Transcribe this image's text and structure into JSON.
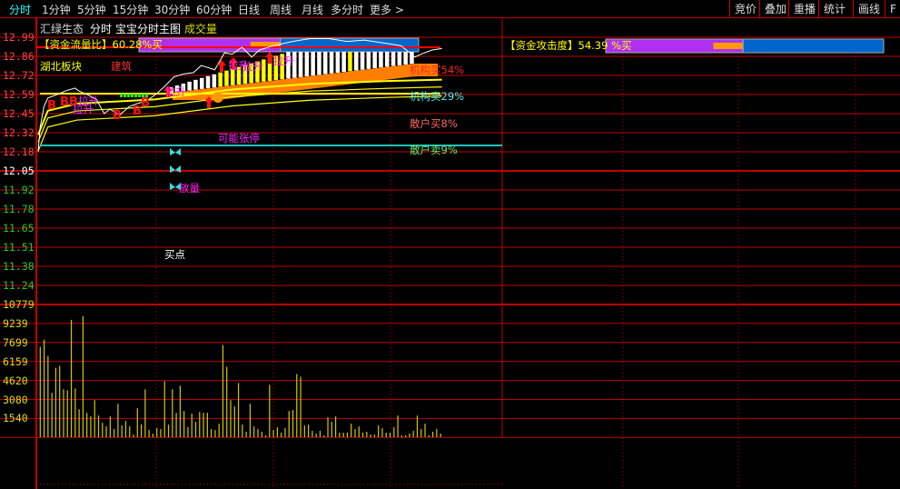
{
  "toolbar": {
    "tabs": [
      {
        "label": "分时",
        "selected": true
      },
      {
        "label": "1分钟"
      },
      {
        "label": "5分钟"
      },
      {
        "label": "15分钟"
      },
      {
        "label": "30分钟"
      },
      {
        "label": "60分钟"
      },
      {
        "label": "日线"
      },
      {
        "label": "周线"
      },
      {
        "label": "月线"
      },
      {
        "label": "多分时"
      },
      {
        "label": "更多 >"
      }
    ],
    "right_buttons": [
      "竞价",
      "叠加",
      "重播",
      "统计",
      "画线",
      "F"
    ]
  },
  "subheader": {
    "stock": "汇绿生态",
    "mode": "分时",
    "indicator": "宝宝分时主图",
    "volume_label": "成交量"
  },
  "price_axis": {
    "labels": [
      "12.99",
      "12.86",
      "12.72",
      "12.59",
      "12.45",
      "12.32",
      "12.18",
      "12.05",
      "11.92",
      "11.78",
      "11.65",
      "11.51",
      "11.38",
      "11.24"
    ],
    "prev_close": "12.05"
  },
  "volume_axis": {
    "labels": [
      "10779",
      "9239",
      "7699",
      "6159",
      "4620",
      "3080",
      "1540"
    ]
  },
  "annotations": {
    "fund_flow_label": "【资金流量比】",
    "fund_flow_value": "60.28%买",
    "fund_flow_buy_ratio": 0.6028,
    "sector": "湖北板块",
    "industry": "建筑",
    "inst_buy": "机构买54%",
    "inst_sell": "机构卖29%",
    "retail_buy": "散户买8%",
    "retail_sell": "散户卖9%",
    "limit_up": "可能张停",
    "volume_up": "放量",
    "buy_point": "买点",
    "b_mark": "B",
    "pull_up": "拉升",
    "attack_label": "【资金攻击度】",
    "attack_value": "54.39 %买",
    "attack_ratio": 0.5439
  },
  "colors": {
    "grid": "#c00000",
    "up": "#ff3b3b",
    "down": "#22cc22",
    "volume": "#d4c800",
    "price_line": "#ffffff",
    "avg_line": "#ffff00",
    "band": "#ff8000",
    "limit_line": "#20c0c0",
    "magenta": "#ff22ff"
  },
  "chart_data": {
    "type": "line",
    "price_range": [
      11.24,
      12.99
    ],
    "price": [
      [
        0,
        12.18
      ],
      [
        1,
        12.35
      ],
      [
        3,
        12.5
      ],
      [
        5,
        12.56
      ],
      [
        9,
        12.58
      ],
      [
        14,
        12.61
      ],
      [
        19,
        12.63
      ],
      [
        21,
        12.61
      ],
      [
        26,
        12.58
      ],
      [
        30,
        12.55
      ],
      [
        34,
        12.45
      ],
      [
        37,
        12.48
      ],
      [
        42,
        12.44
      ],
      [
        47,
        12.5
      ],
      [
        51,
        12.52
      ],
      [
        56,
        12.54
      ],
      [
        61,
        12.59
      ],
      [
        65,
        12.64
      ],
      [
        70,
        12.71
      ],
      [
        75,
        12.73
      ],
      [
        80,
        12.74
      ],
      [
        84,
        12.79
      ],
      [
        91,
        12.76
      ],
      [
        96,
        12.88
      ],
      [
        100,
        12.87
      ],
      [
        105,
        12.92
      ],
      [
        110,
        12.85
      ],
      [
        114,
        12.9
      ],
      [
        121,
        12.93
      ],
      [
        131,
        12.96
      ],
      [
        140,
        12.98
      ],
      [
        150,
        12.98
      ],
      [
        159,
        12.96
      ],
      [
        168,
        12.97
      ],
      [
        178,
        12.95
      ],
      [
        187,
        12.93
      ],
      [
        194,
        12.85
      ],
      [
        199,
        12.88
      ],
      [
        203,
        12.9
      ],
      [
        208,
        12.91
      ]
    ],
    "avg": [
      [
        0,
        12.3
      ],
      [
        5,
        12.47
      ],
      [
        20,
        12.52
      ],
      [
        60,
        12.55
      ],
      [
        100,
        12.62
      ],
      [
        140,
        12.66
      ],
      [
        180,
        12.68
      ],
      [
        208,
        12.69
      ]
    ],
    "volume": [
      7333,
      7920,
      6600,
      3593,
      5646,
      5793,
      3886,
      3813,
      9533,
      3960,
      2273,
      9827,
      1980,
      1687,
      3007,
      1760,
      1173,
      880,
      1687,
      660,
      2713,
      953,
      1320,
      880,
      220,
      2347,
      1027,
      3886,
      587,
      293,
      733,
      660,
      4547,
      1027,
      3886,
      1980,
      4180,
      2127,
      807,
      1907,
      1247,
      2053,
      1980,
      1980,
      660,
      587,
      1100,
      7480,
      5720,
      3007,
      2493,
      4400,
      1027,
      440,
      2713,
      880,
      660,
      440,
      147,
      4253,
      587,
      807,
      367,
      733,
      2127,
      2200,
      5133,
      4913,
      953,
      1027,
      513,
      293,
      513,
      147,
      1613,
      1247,
      1687,
      367,
      367,
      367,
      1100,
      660,
      880,
      367,
      440,
      220,
      220,
      953,
      733,
      367,
      367,
      807,
      1760,
      147,
      147,
      293,
      513,
      1760,
      660,
      1100,
      147,
      440,
      660,
      293
    ],
    "volume_range": [
      0,
      10779
    ]
  }
}
